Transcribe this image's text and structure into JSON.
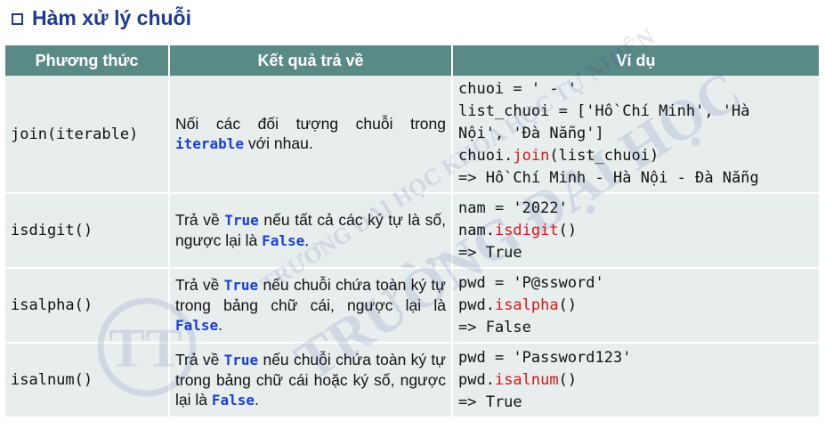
{
  "title": "Hàm xử lý chuỗi",
  "watermark": {
    "line1": "TRƯỜNG ĐẠI HỌC KHOA HỌC TỰ NHIÊN",
    "line2": "TRƯỜNG ĐẠI HỌC",
    "logo": "TT"
  },
  "headers": [
    "Phương thức",
    "Kết quả trả về",
    "Ví dụ"
  ],
  "rows": [
    {
      "method": "join(iterable)",
      "desc_a": "Nối các đối tượng chuỗi trong ",
      "kw1": "iterable",
      "desc_b": " với nhau.",
      "ex1": "chuoi = ' - '",
      "ex2": "list_chuoi = ['Hồ Chí Minh', 'Hà",
      "ex3": "Nội', 'Đà Nẵng']",
      "ex4_pre": "chuoi.",
      "ex4_fn": "join",
      "ex4_post": "(list_chuoi)",
      "ex5": "=> Hồ Chí Minh - Hà Nội - Đà Nẵng"
    },
    {
      "method": "isdigit()",
      "desc_a": "Trả về ",
      "kw1": "True",
      "desc_b": " nếu tất cả các ký tự là số, ngược lại là ",
      "kw2": "False",
      "desc_c": ".",
      "ex1": "nam = '2022'",
      "ex2_pre": "nam.",
      "ex2_fn": "isdigit",
      "ex2_post": "()",
      "ex3": "=> True"
    },
    {
      "method": "isalpha()",
      "desc_a": "Trả về ",
      "kw1": "True",
      "desc_b": " nếu chuỗi chứa toàn ký tự trong bảng chữ cái, ngược lại là ",
      "kw2": "False",
      "desc_c": ".",
      "ex1": "pwd = 'P@ssword'",
      "ex2_pre": "pwd.",
      "ex2_fn": "isalpha",
      "ex2_post": "()",
      "ex3": "=> False"
    },
    {
      "method": "isalnum()",
      "desc_a": "Trả về ",
      "kw1": "True",
      "desc_b": " nếu chuỗi chứa toàn ký tự trong bảng chữ cái hoặc ký số, ngược lại là ",
      "kw2": "False",
      "desc_c": ".",
      "ex1": "pwd = 'Password123'",
      "ex2_pre": "pwd.",
      "ex2_fn": "isalnum",
      "ex2_post": "()",
      "ex3": "=> True"
    }
  ],
  "colors": {
    "title": "#1f3a93",
    "header_bg": "#5a8a86",
    "row_bg": "#e8eeee",
    "keyword": "#1b3fd0",
    "function": "#d01818"
  }
}
